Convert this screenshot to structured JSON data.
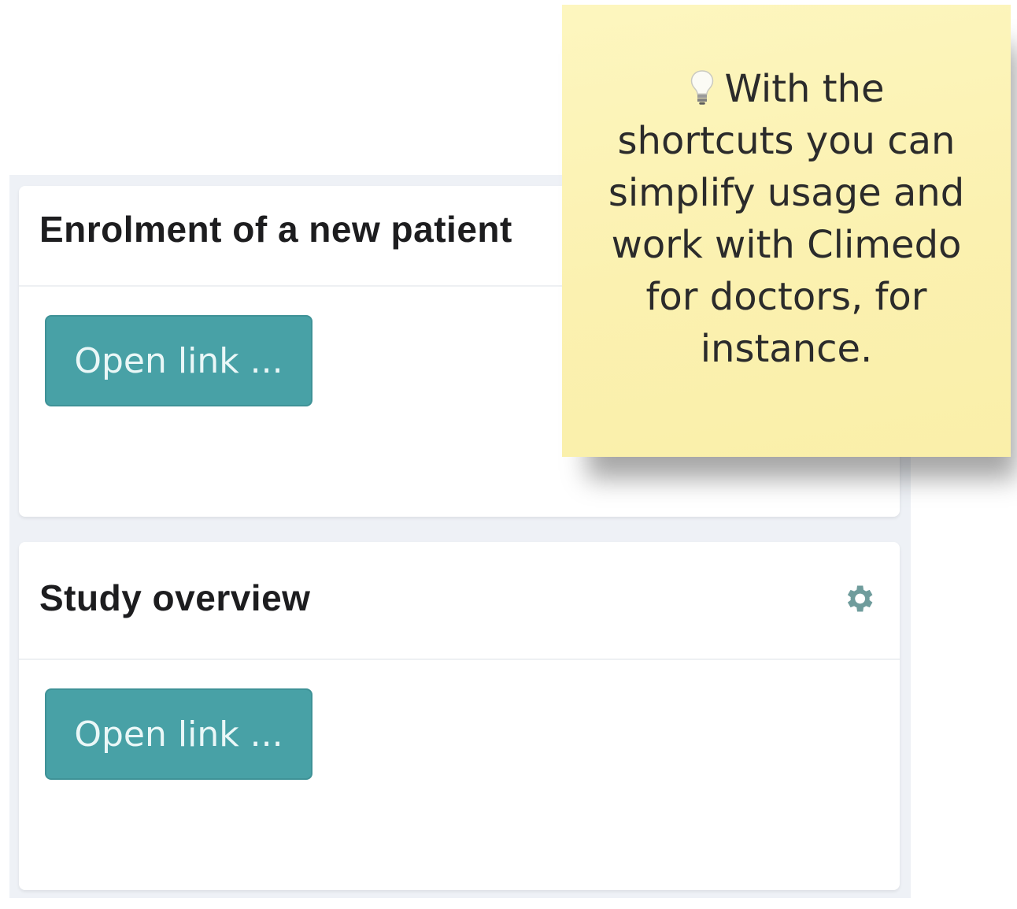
{
  "cards": [
    {
      "title": "Enrolment of a new patient",
      "button_label": "Open link ..."
    },
    {
      "title": "Study overview",
      "button_label": "Open link ...",
      "settings_icon": "gear-icon"
    }
  ],
  "sticky_note": {
    "icon": "lightbulb-icon",
    "text": "With the shortcuts you can simplify usage and work with Climedo for doctors, for instance."
  },
  "colors": {
    "button": "#48a1a6",
    "note": "#fcf4b6",
    "background": "#eef1f6"
  }
}
